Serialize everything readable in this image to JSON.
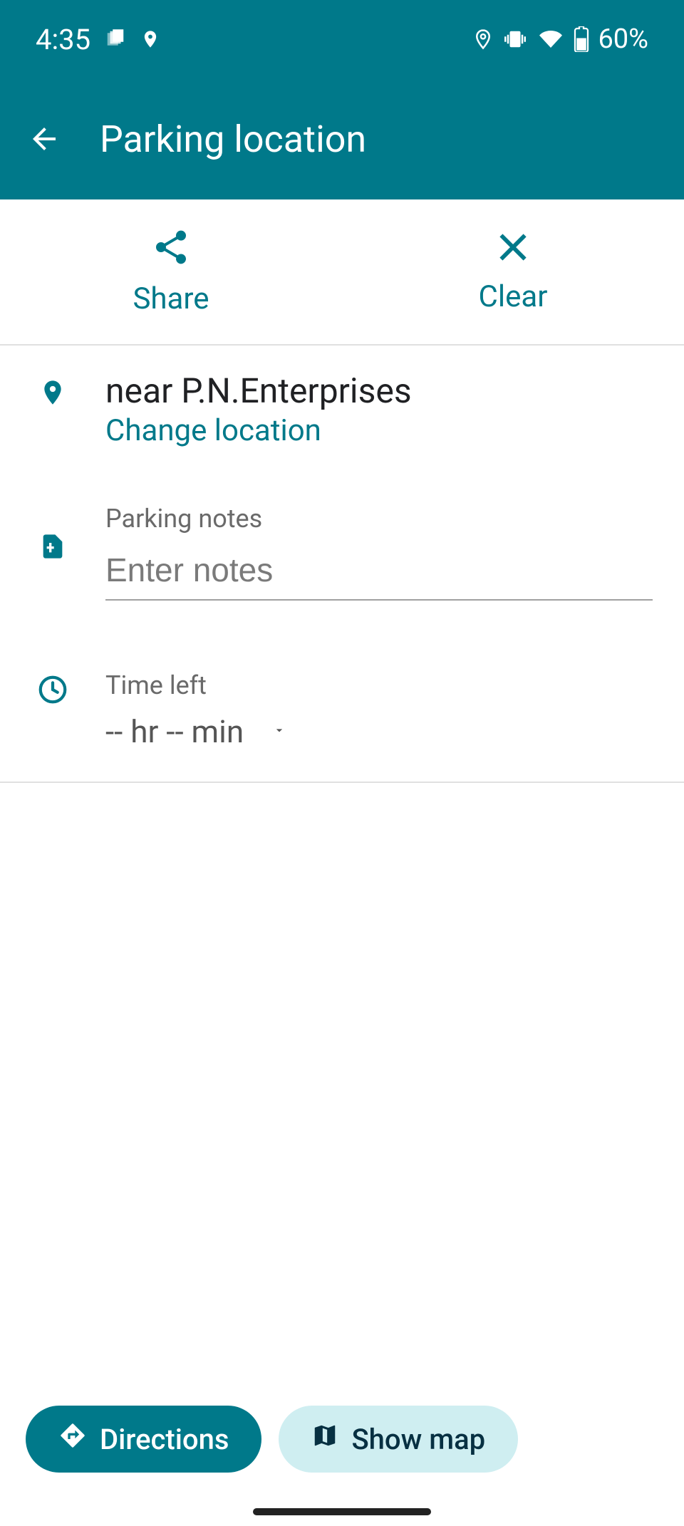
{
  "status": {
    "time": "4:35",
    "battery_text": "60%"
  },
  "app_bar": {
    "title": "Parking location"
  },
  "actions": {
    "share_label": "Share",
    "clear_label": "Clear"
  },
  "location": {
    "name": "near P.N.Enterprises",
    "change_link": "Change location"
  },
  "notes": {
    "label": "Parking notes",
    "placeholder": "Enter notes",
    "value": ""
  },
  "time_left": {
    "label": "Time left",
    "value": "-- hr -- min"
  },
  "fabs": {
    "directions": "Directions",
    "show_map": "Show map"
  }
}
